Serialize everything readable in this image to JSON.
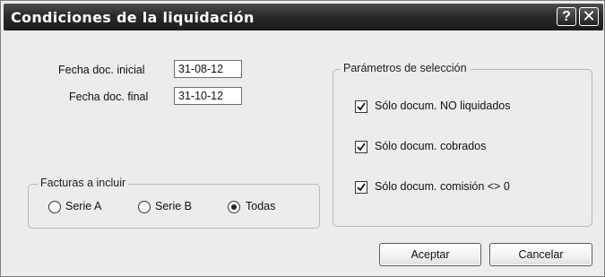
{
  "window": {
    "title": "Condiciones de la liquidación",
    "help_glyph": "?",
    "close_glyph": "✕"
  },
  "dates": {
    "start_label": "Fecha doc. inicial",
    "start_value": "31-08-12",
    "end_label": "Fecha doc. final",
    "end_value": "31-10-12"
  },
  "invoices_group": {
    "title": "Facturas a incluir",
    "options": [
      {
        "label": "Serie A",
        "selected": false
      },
      {
        "label": "Serie B",
        "selected": false
      },
      {
        "label": "Todas",
        "selected": true
      }
    ]
  },
  "selection_group": {
    "title": "Parámetros de selección",
    "options": [
      {
        "label": "Sólo docum. NO liquidados",
        "checked": true
      },
      {
        "label": "Sólo docum. cobrados",
        "checked": true
      },
      {
        "label": "Sólo docum. comisión <> 0",
        "checked": true
      }
    ]
  },
  "buttons": {
    "accept": "Aceptar",
    "cancel": "Cancelar"
  }
}
